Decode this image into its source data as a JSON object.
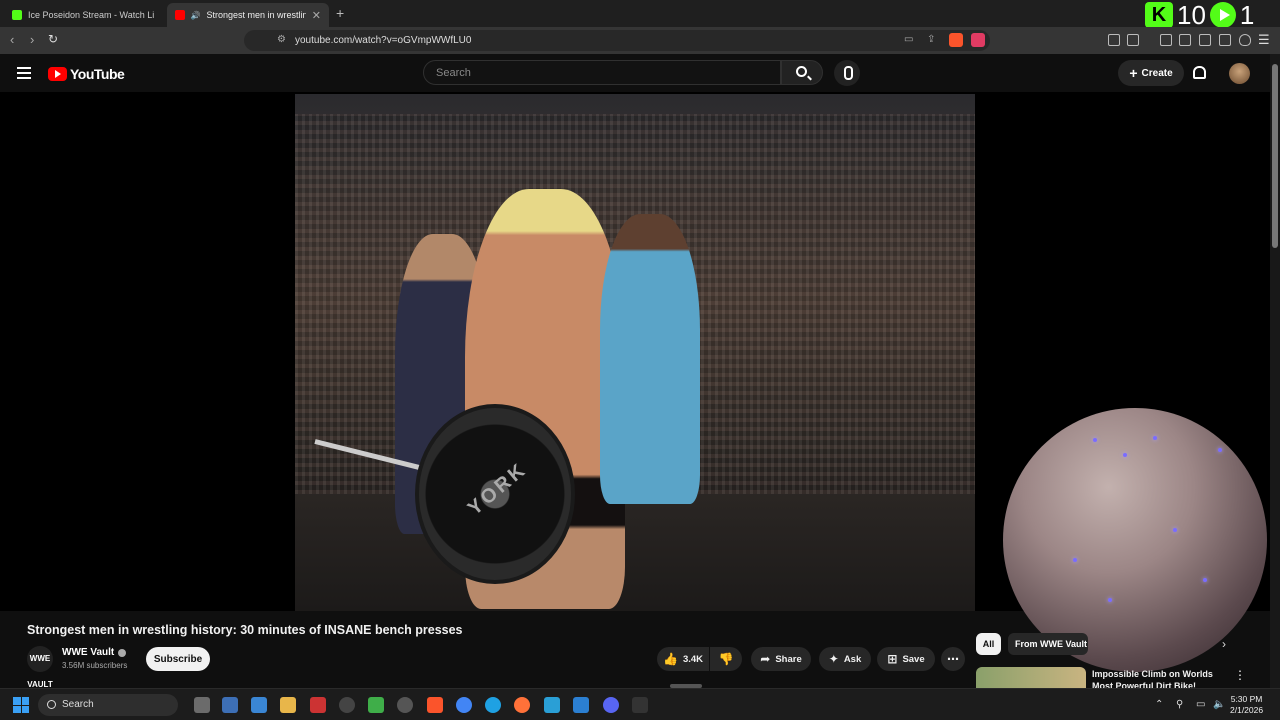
{
  "browser": {
    "tabs": [
      {
        "label": "Ice Poseidon Stream - Watch Live on",
        "active": false
      },
      {
        "label": "Strongest men in wrestling hi",
        "active": true
      }
    ],
    "url": "youtube.com/watch?v=oGVmpWWfLU0",
    "kick_counter": "10",
    "kick_counter_2": "1"
  },
  "youtube": {
    "logo_text": "YouTube",
    "search_placeholder": "Search",
    "create_label": "Create"
  },
  "video": {
    "plate_text": "YORK",
    "title": "Strongest men in wrestling history: 30 minutes of INSANE bench presses",
    "channel_name": "WWE Vault",
    "channel_avatar_text": "WWE VAULT",
    "subscribers": "3.56M subscribers",
    "subscribe_label": "Subscribe",
    "likes": "3.4K",
    "share_label": "Share",
    "ask_label": "Ask",
    "save_label": "Save"
  },
  "sidebar": {
    "chip_all": "All",
    "chip_from": "From WWE Vault",
    "rec_title": "Impossible Climb on Worlds Most Powerful Dirt Bike!"
  },
  "taskbar": {
    "search_label": "Search",
    "time": "5:30 PM",
    "date": "2/1/2026"
  },
  "colors": {
    "background": "#0f0f0f",
    "youtube_red": "#ff0000",
    "kick_green": "#53fc18"
  }
}
